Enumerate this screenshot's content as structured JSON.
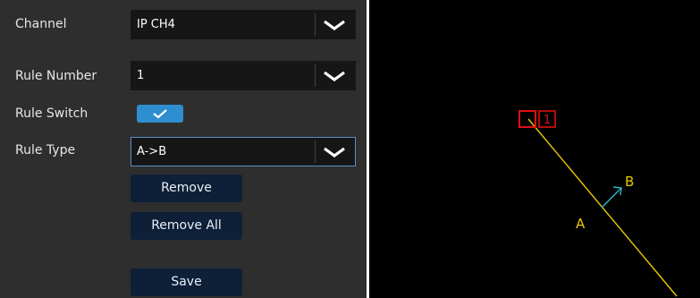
{
  "form": {
    "channel": {
      "label": "Channel",
      "value": "IP CH4"
    },
    "rule_number": {
      "label": "Rule Number",
      "value": "1"
    },
    "rule_switch": {
      "label": "Rule Switch",
      "enabled": true
    },
    "rule_type": {
      "label": "Rule Type",
      "value": "A->B"
    },
    "remove_label": "Remove",
    "remove_all_label": "Remove All",
    "save_label": "Save"
  },
  "preview": {
    "point_a_label": "A",
    "point_b_label": "B",
    "rule_index_label": "1"
  },
  "colors": {
    "panel_bg": "#2e2e2e",
    "field_bg": "#161616",
    "button_bg": "#0e2038",
    "toggle_on": "#2f8ecf",
    "rule_line": "#e6c800",
    "direction_arrow": "#2ab7c8",
    "marker_red": "#e01010"
  }
}
